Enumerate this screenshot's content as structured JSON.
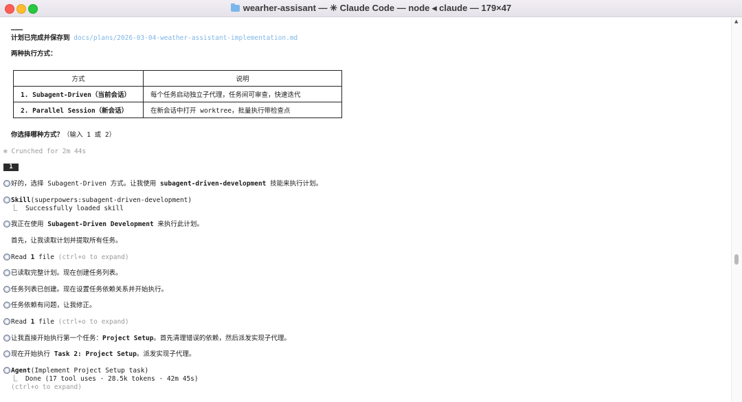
{
  "window": {
    "title": "wearher-assisant — ✳ Claude Code — node ◂ claude — 179×47"
  },
  "content": {
    "separator": "———",
    "plan_saved_label": "计划已完成并保存到",
    "plan_path": "docs/plans/2026-03-04-weather-assistant-implementation.md",
    "modes_heading": "两种执行方式：",
    "table": {
      "headers": [
        "方式",
        "说明"
      ],
      "rows": [
        [
          "1. Subagent-Driven（当前会话）",
          "每个任务启动独立子代理，任务间可审查，快速迭代"
        ],
        [
          "2. Parallel Session（新会话）",
          "在新会话中打开 worktree，批量执行带检查点"
        ]
      ]
    },
    "question_bold": "你选择哪种方式？",
    "question_hint": "（输入 1 或 2）",
    "crunched": "✻ Crunched for 2m 44s",
    "user_input": "1",
    "msg_choice_pre": "好的，选择 Subagent-Driven 方式。让我使用 ",
    "msg_choice_skill": "subagent-driven-development",
    "msg_choice_post": " 技能来执行计划。",
    "skill_name": "Skill",
    "skill_args": "(superpowers:subagent-driven-development)",
    "skill_result": "⎿  Successfully loaded skill",
    "using_pre": "我正在使用 ",
    "using_bold": "Subagent-Driven Development",
    "using_post": " 来执行此计划。",
    "first_line": "首先，让我读取计划并提取所有任务。",
    "read_label": "Read ",
    "read_count": "1",
    "read_file": " file ",
    "read_hint": "(ctrl+o to expand)",
    "read_plan": "已读取完整计划。现在创建任务列表。",
    "tasks_created": "任务列表已创建。现在设置任务依赖关系并开始执行。",
    "deps_issue": "任务依赖有问题，让我修正。",
    "read2_label": "Read ",
    "read2_count": "1",
    "read2_file": " file ",
    "read2_hint": "(ctrl+o to expand)",
    "start_pre": "让我直接开始执行第一个任务：",
    "start_bold": "Project Setup",
    "start_post": "。首先清理错误的依赖，然后派发实现子代理。",
    "exec_pre": "现在开始执行 ",
    "exec_bold": "Task 2: Project Setup",
    "exec_post": "。派发实现子代理。",
    "agent_name": "Agent",
    "agent_args": "(Implement Project Setup task)",
    "agent_result": "⎿  Done (17 tool uses · 28.5k tokens · 42m 45s)",
    "agent_hint": "(ctrl+o to expand)"
  },
  "colors": {
    "link": "#7fb6e6",
    "muted": "#9a9a9a",
    "bullet": "#5c6a86"
  }
}
